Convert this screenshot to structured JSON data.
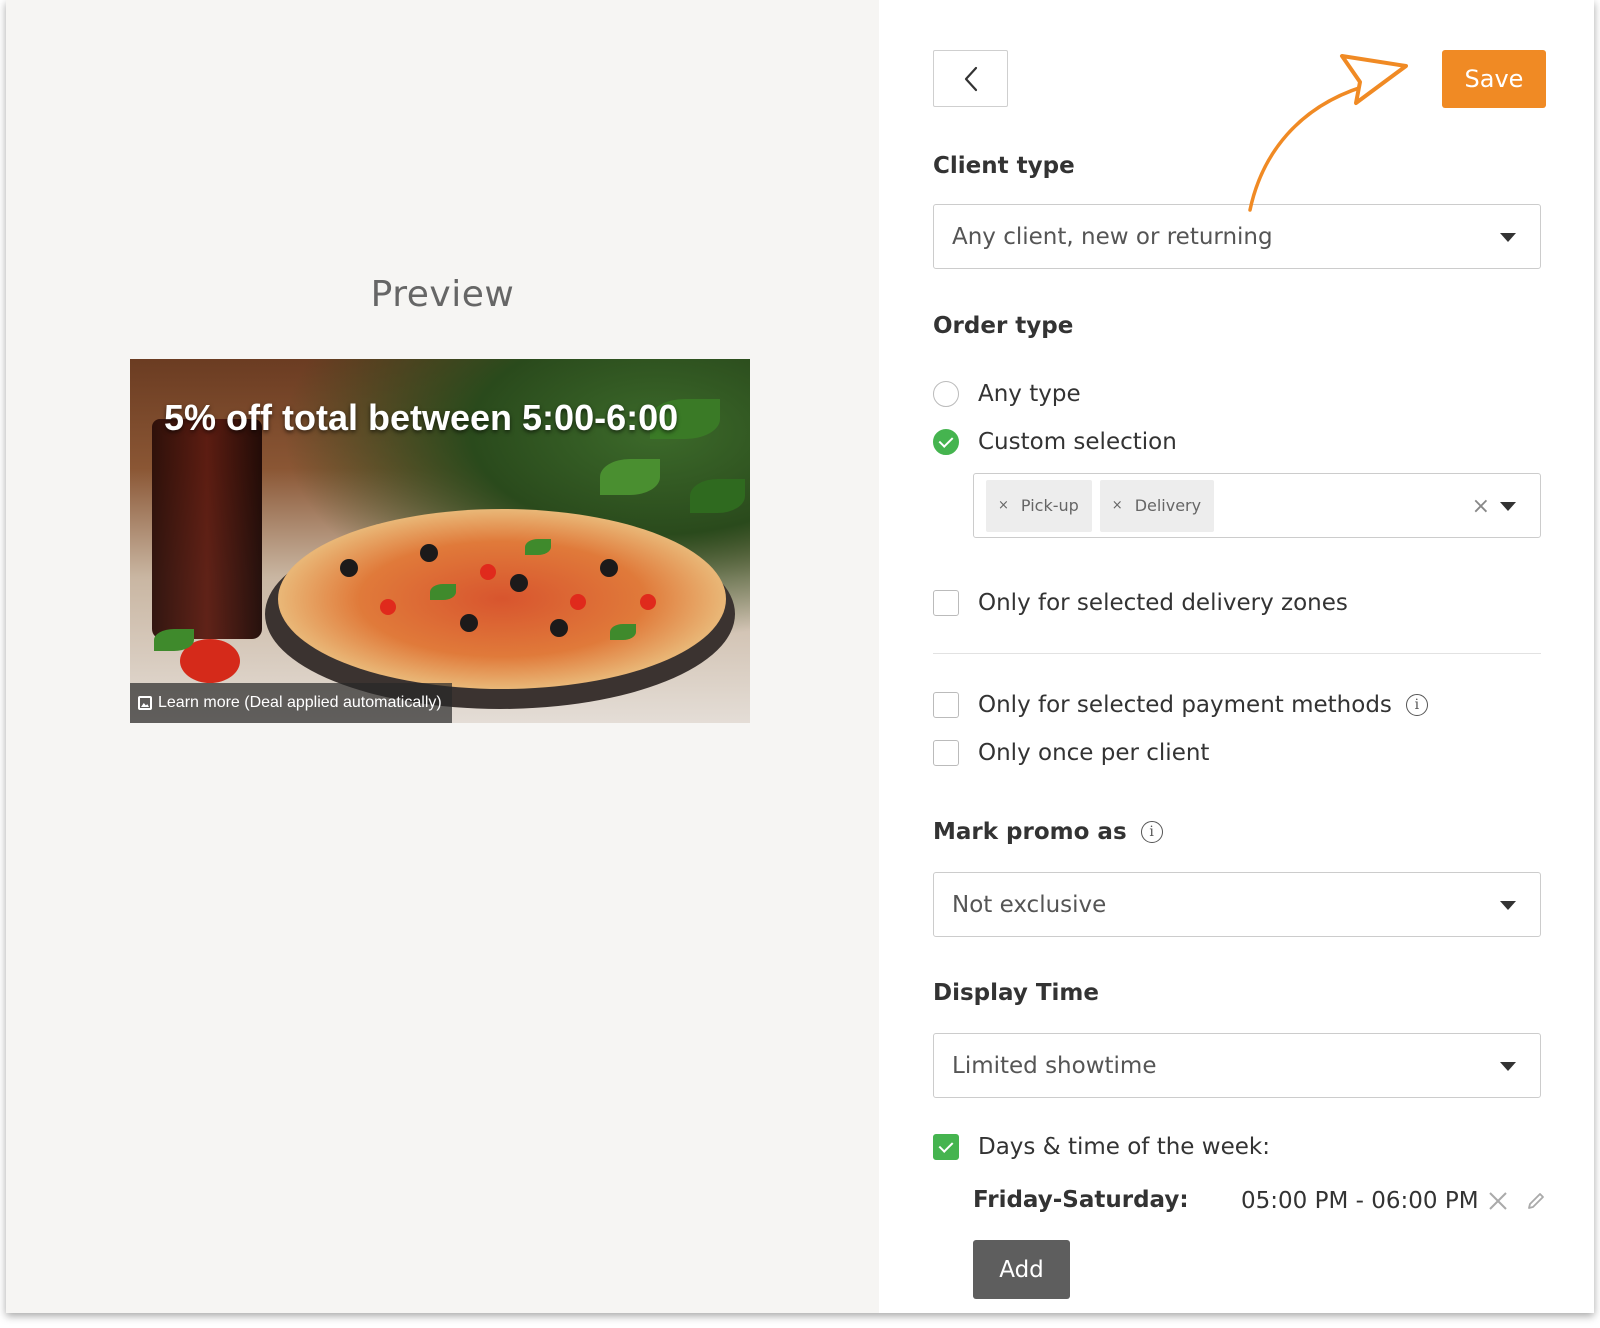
{
  "preview": {
    "title": "Preview",
    "deal_title": "5% off total between 5:00-6:00",
    "footer_text": "Learn more (Deal applied automatically)"
  },
  "toolbar": {
    "back_icon": "chevron-left-icon",
    "save_label": "Save"
  },
  "client_type": {
    "label": "Client type",
    "value": "Any client, new or returning"
  },
  "order_type": {
    "label": "Order type",
    "options": [
      {
        "label": "Any type",
        "checked": false
      },
      {
        "label": "Custom selection",
        "checked": true
      }
    ],
    "selected_tags": [
      "Pick-up",
      "Delivery"
    ]
  },
  "filters": {
    "delivery_zones": "Only for selected delivery zones",
    "payment_methods": "Only for selected payment methods",
    "once_per_client": "Only once per client"
  },
  "mark_promo": {
    "label": "Mark promo as",
    "value": "Not exclusive"
  },
  "display_time": {
    "label": "Display Time",
    "value": "Limited showtime",
    "days_time_label": "Days & time of the week:",
    "schedule": [
      {
        "days": "Friday-Saturday:",
        "time": "05:00 PM - 06:00 PM"
      }
    ],
    "add_label": "Add"
  },
  "colors": {
    "accent": "#f08a24",
    "success": "#45b44f",
    "dark_button": "#5e5e5e"
  }
}
